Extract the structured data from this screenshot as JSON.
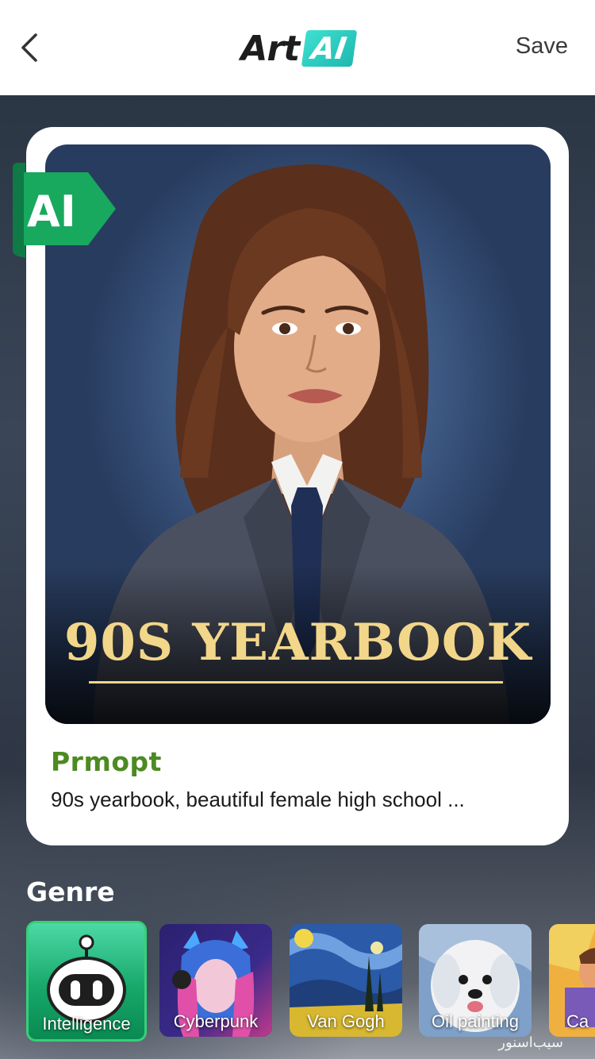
{
  "header": {
    "back_icon": "chevron-left-icon",
    "brand_text": "Art",
    "brand_badge": "AI",
    "save_label": "Save"
  },
  "card": {
    "badge": "AI",
    "image_title": "90S YEARBOOK",
    "prompt_label": "Prmopt",
    "prompt_text": "90s yearbook, beautiful female high school ..."
  },
  "genre": {
    "heading": "Genre",
    "items": [
      {
        "label": "Intelligence",
        "icon": "robot-icon",
        "selected": true
      },
      {
        "label": "Cyberpunk",
        "selected": false
      },
      {
        "label": "Van Gogh",
        "selected": false
      },
      {
        "label": "Oil painting",
        "selected": false
      },
      {
        "label": "Ca",
        "selected": false
      }
    ]
  },
  "watermark": "سیب‌اسنور",
  "colors": {
    "accent_green": "#4d8a22",
    "selected_border": "#36d07a",
    "title_gold": "#f2d68a",
    "brand_teal": "#2fc8bf"
  }
}
